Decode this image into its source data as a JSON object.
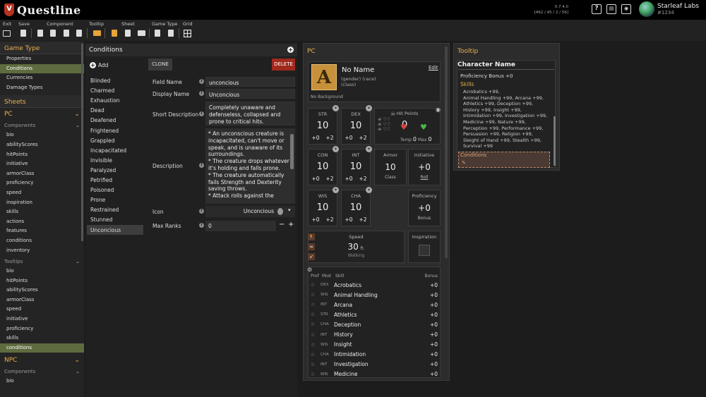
{
  "app": {
    "name": "Questline",
    "version": "0.7.4.0",
    "stats": "[462 / 45 / 2 / 56]"
  },
  "user": {
    "name": "Starleaf Labs",
    "id": "#1234"
  },
  "toolbar": {
    "groups": {
      "exit": "Exit",
      "save": "Save",
      "component": "Component",
      "tooltip": "Tooltip",
      "sheet": "Sheet",
      "game_type": "Game Type",
      "grid": "Grid"
    }
  },
  "sidebar": {
    "game_type_title": "Game Type",
    "game_type_items": [
      "Properties",
      "Conditions",
      "Currencies",
      "Damage Types"
    ],
    "sheets_title": "Sheets",
    "pc_title": "PC",
    "components_label": "Components",
    "pc_components": [
      "bio",
      "abilityScores",
      "hitPoints",
      "initiative",
      "armorClass",
      "proficiency",
      "speed",
      "inspiration",
      "skills",
      "actions",
      "features",
      "conditions",
      "inventory"
    ],
    "tooltips_label": "Tooltips",
    "pc_tooltips": [
      "bio",
      "hitPoints",
      "abilityScores",
      "armorClass",
      "speed",
      "initiative",
      "proficiency",
      "skills",
      "conditions"
    ],
    "npc_title": "NPC",
    "npc_components": [
      "bio"
    ]
  },
  "conditions": {
    "title": "Conditions",
    "add_label": "Add",
    "clone_label": "CLONE",
    "delete_label": "DELETE",
    "list": [
      "Blinded",
      "Charmed",
      "Exhaustion",
      "Dead",
      "Deafened",
      "Frightened",
      "Grappled",
      "Incapacitated",
      "Invisible",
      "Paralyzed",
      "Petrified",
      "Poisoned",
      "Prone",
      "Restrained",
      "Stunned",
      "Unconcious"
    ],
    "fields": {
      "field_name_label": "Field Name",
      "field_name": "unconcious",
      "display_name_label": "Display Name",
      "display_name": "Unconcious",
      "short_desc_label": "Short Description",
      "short_desc": "Completely unaware and defenseless, collapsed and prone to critical hits.",
      "desc_label": "Description",
      "desc": "* An unconscious creature is incapacitated, can't move or speak, and is unaware of its surroundings.\n* The creature drops whatever it's holding and falls prone.\n* The creature automatically fails Strength and Dexterity saving throws.\n* Attack rolls against the",
      "icon_label": "Icon",
      "icon_value": "Unconcious",
      "max_ranks_label": "Max Ranks",
      "max_ranks": "0"
    }
  },
  "pc": {
    "title": "PC",
    "name": "No Name",
    "edit": "Edit",
    "sub1": "(gender) (race)",
    "sub2": "(class)",
    "background": "No Background",
    "abilities": [
      {
        "abbr": "STR",
        "score": "10",
        "m1": "+0",
        "m2": "+2"
      },
      {
        "abbr": "DEX",
        "score": "10",
        "m1": "+0",
        "m2": "+2"
      },
      {
        "abbr": "CON",
        "score": "10",
        "m1": "+0",
        "m2": "+2"
      },
      {
        "abbr": "INT",
        "score": "10",
        "m1": "+0",
        "m2": "+2"
      },
      {
        "abbr": "WIS",
        "score": "10",
        "m1": "+0",
        "m2": "+2"
      },
      {
        "abbr": "CHA",
        "score": "10",
        "m1": "+0",
        "m2": "+2"
      }
    ],
    "hp": {
      "label": "Hit Points",
      "value": "0",
      "temp_label": "Temp",
      "temp": "0",
      "max_label": "Max",
      "max": "0"
    },
    "armor": {
      "label": "Armor",
      "value": "10",
      "foot": "Class"
    },
    "initiative": {
      "label": "Initiative",
      "value": "+0",
      "foot": "Roll"
    },
    "proficiency": {
      "label": "Proficiency",
      "value": "+0",
      "foot": "Bonus"
    },
    "speed": {
      "label": "Speed",
      "value": "30",
      "unit": "ft.",
      "foot": "Walking"
    },
    "inspiration": {
      "label": "Inspiration"
    },
    "skills_head": {
      "prof": "Prof",
      "mod": "Mod",
      "skill": "Skill",
      "bonus": "Bonus"
    },
    "skills": [
      {
        "ab": "DEX",
        "name": "Acrobatics",
        "bonus": "+0"
      },
      {
        "ab": "WIS",
        "name": "Animal Handling",
        "bonus": "+0"
      },
      {
        "ab": "INT",
        "name": "Arcana",
        "bonus": "+0"
      },
      {
        "ab": "STR",
        "name": "Athletics",
        "bonus": "+0"
      },
      {
        "ab": "CHA",
        "name": "Deception",
        "bonus": "+0"
      },
      {
        "ab": "INT",
        "name": "History",
        "bonus": "+0"
      },
      {
        "ab": "WIS",
        "name": "Insight",
        "bonus": "+0"
      },
      {
        "ab": "CHA",
        "name": "Intimidation",
        "bonus": "+0"
      },
      {
        "ab": "INT",
        "name": "Investigation",
        "bonus": "+0"
      },
      {
        "ab": "WIS",
        "name": "Medicine",
        "bonus": "+0"
      }
    ]
  },
  "tooltip": {
    "title": "Tooltip",
    "char_name": "Character Name",
    "prof": "Proficiency Bonus +0",
    "skills_label": "Skills",
    "skills_text": "Acrobatics +99,\nAnimal Handling +99, Arcana +99,\nAthletics +99, Deception +99,\nHistory +99, Insight +99,\nIntimidation +99, Investigation +99,\nMedicine +99, Nature +99,\nPerception +99, Performance +99,\nPersuasion +99, Religion +99,\nSleight of Hand +99, Stealth +99,\nSurvival +99",
    "conditions_label": "Conditions"
  },
  "colors": {
    "accent": "#e8b04f",
    "selected": "#5d6b3f",
    "delete": "#a1281c"
  }
}
